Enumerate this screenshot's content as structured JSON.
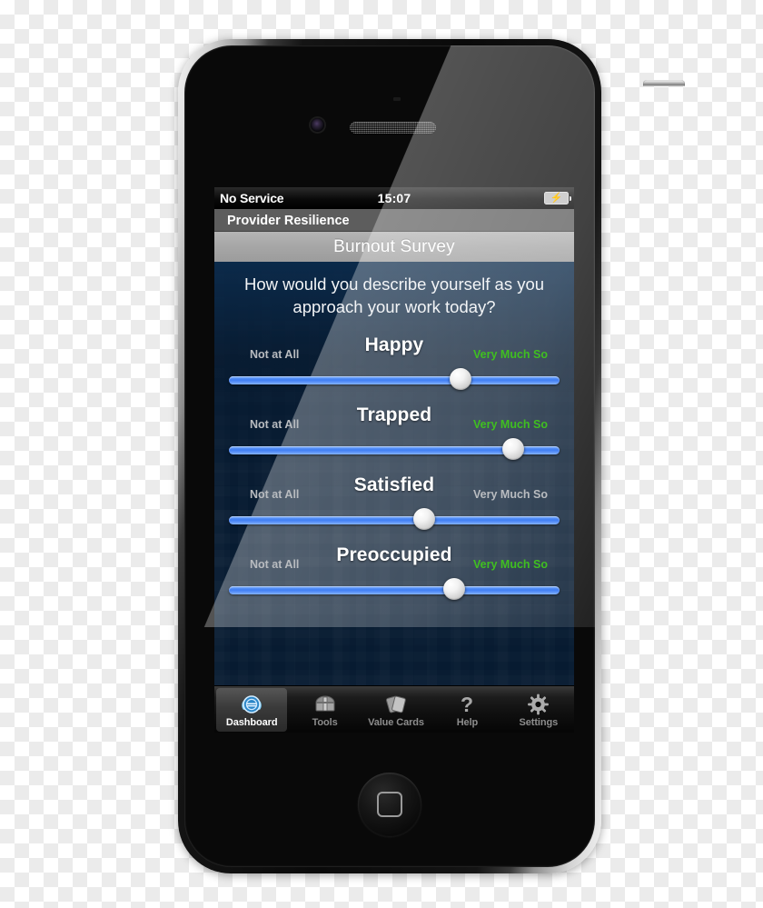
{
  "device": {
    "type": "smartphone-mockup",
    "hardware": {
      "camera": "front-camera",
      "earpiece": "earpiece-speaker",
      "home_button": "home-button",
      "mute_switch": "mute-switch",
      "volume_up": "volume-up-button",
      "volume_down": "volume-down-button",
      "power": "power-button"
    }
  },
  "status_bar": {
    "carrier": "No Service",
    "clock": "15:07",
    "battery_icon": "battery-charging-icon",
    "bolt_glyph": "⚡"
  },
  "nav_bar": {
    "title": "Provider Resilience"
  },
  "section_bar": {
    "title": "Burnout Survey"
  },
  "survey": {
    "question": "How would you describe yourself as you approach your work today?",
    "anchor_low": "Not at All",
    "anchor_high": "Very Much So",
    "items": [
      {
        "name": "Happy",
        "value_percent": 70,
        "high_anchor_highlighted": true
      },
      {
        "name": "Trapped",
        "value_percent": 86,
        "high_anchor_highlighted": true
      },
      {
        "name": "Satisfied",
        "value_percent": 59,
        "high_anchor_highlighted": false
      },
      {
        "name": "Preoccupied",
        "value_percent": 68,
        "high_anchor_highlighted": true
      }
    ]
  },
  "tab_bar": {
    "tabs": [
      {
        "label": "Dashboard",
        "icon": "gauge-dashboard-icon",
        "active": true
      },
      {
        "label": "Tools",
        "icon": "treasure-chest-icon",
        "active": false
      },
      {
        "label": "Value Cards",
        "icon": "cards-icon",
        "active": false
      },
      {
        "label": "Help",
        "icon": "question-mark-icon",
        "active": false
      },
      {
        "label": "Settings",
        "icon": "gear-icon",
        "active": false
      }
    ]
  },
  "colors": {
    "screen_bg": "#071b31",
    "nav_bar": "#5d5d5d",
    "section_bar": "#a6a6a6",
    "slider_track": "#3f7ef4",
    "anchor_highlight": "#3fbf20",
    "anchor_muted": "#b9bcc0"
  }
}
